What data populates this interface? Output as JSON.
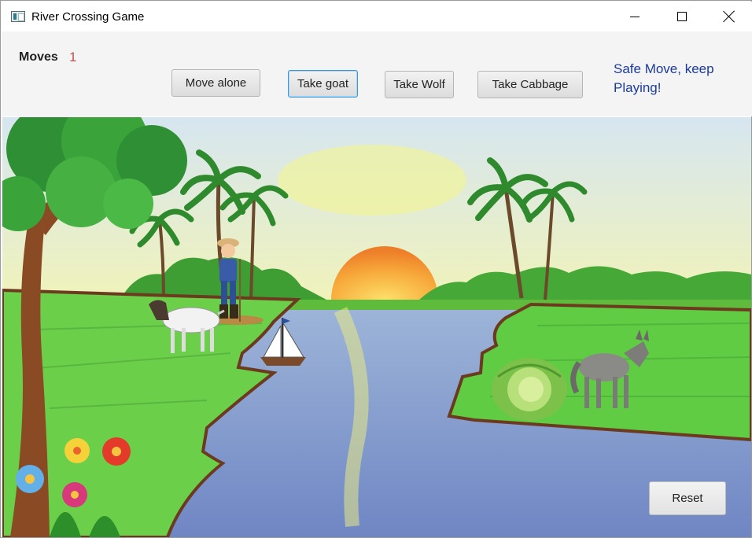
{
  "window": {
    "title": "River Crossing Game"
  },
  "stats": {
    "moves_label": "Moves",
    "moves_value": "1"
  },
  "actions": {
    "move_alone": "Move alone",
    "take_goat": "Take goat",
    "take_wolf": "Take Wolf",
    "take_cabbage": "Take Cabbage"
  },
  "status": {
    "message": "Safe Move, keep Playing!"
  },
  "controls": {
    "reset": "Reset"
  },
  "scene": {
    "left_bank": [
      "farmer",
      "goat"
    ],
    "boat_side": "left",
    "right_bank": [
      "cabbage",
      "wolf"
    ]
  },
  "colors": {
    "moves_value": "#c0504d",
    "status_text": "#1b3aa0",
    "focus_ring": "#3a9ad9"
  }
}
